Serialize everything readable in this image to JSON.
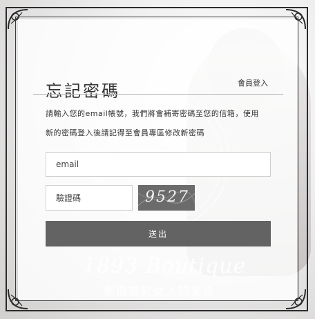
{
  "page": {
    "title": "忘記密碼",
    "member_login_link": "會員登入",
    "instructions": {
      "line1": "請輸入您的email帳號，我們將會補寄密碼至您的信箱，使用",
      "line2": "新的密碼登入後請記得至會員專區修改新密碼"
    }
  },
  "form": {
    "email_placeholder": "email",
    "captcha_placeholder": "驗證碼",
    "captcha_image_text": "9527",
    "submit_label": "送出"
  },
  "background": {
    "watermark_text": "1893 Boutique",
    "tagline": "創造屬於女人的驚奇"
  },
  "colors": {
    "button_bg": "#636363",
    "captcha_bg": "#6b6b6b",
    "frame": "#2b2b2b"
  }
}
